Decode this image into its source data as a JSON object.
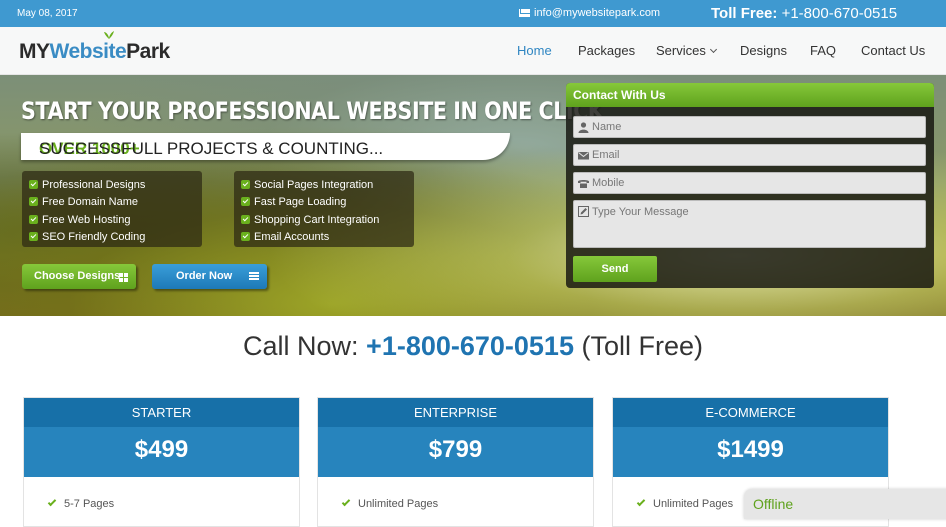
{
  "topbar": {
    "date": "May 08, 2017",
    "email": "info@mywebsitepark.com",
    "toll_label": "Toll Free:",
    "toll_number": "+1-800-670-0515"
  },
  "logo": {
    "part1": "MY",
    "part2": "Website",
    "part3": "Park"
  },
  "nav": {
    "items": [
      {
        "label": "Home",
        "active": true
      },
      {
        "label": "Packages"
      },
      {
        "label": "Services"
      },
      {
        "label": "Designs"
      },
      {
        "label": "FAQ"
      },
      {
        "label": "Contact Us"
      }
    ]
  },
  "hero": {
    "title": "START YOUR PROFESSIONAL WEBSITE IN ONE CLICK",
    "banner_highlight": "OVER 1000+",
    "banner_text": "SUCCESSFULL PROJECTS & COUNTING...",
    "features_left": [
      "Professional Designs",
      "Free Domain Name",
      "Free Web Hosting",
      "SEO Friendly Coding"
    ],
    "features_right": [
      "Social Pages Integration",
      "Fast Page Loading",
      "Shopping Cart Integration",
      "Email Accounts"
    ],
    "choose_designs": "Choose Designs",
    "order_now": "Order Now"
  },
  "contact": {
    "title": "Contact With Us",
    "name_placeholder": "Name",
    "email_placeholder": "Email",
    "mobile_placeholder": "Mobile",
    "message_placeholder": "Type Your Message",
    "send": "Send"
  },
  "callnow": {
    "prefix": "Call Now:",
    "number": "+1-800-670-0515",
    "suffix": "(Toll Free)"
  },
  "plans": [
    {
      "name": "STARTER",
      "price": "$499",
      "first_feature": "5-7 Pages"
    },
    {
      "name": "ENTERPRISE",
      "price": "$799",
      "first_feature": "Unlimited Pages"
    },
    {
      "name": "E-COMMERCE",
      "price": "$1499",
      "first_feature": "Unlimited Pages"
    }
  ],
  "chat": {
    "status": "Offline"
  },
  "colors": {
    "brand_blue": "#3f99d0",
    "accent_green": "#6ab01d",
    "plan_header": "#1770a8",
    "plan_price": "#2784bd"
  },
  "icons": [
    "mail-icon",
    "leaf-icon",
    "chevron-down-icon",
    "check-icon",
    "grid-icon",
    "list-icon",
    "user-icon",
    "envelope-icon",
    "phone-icon",
    "pencil-icon"
  ]
}
